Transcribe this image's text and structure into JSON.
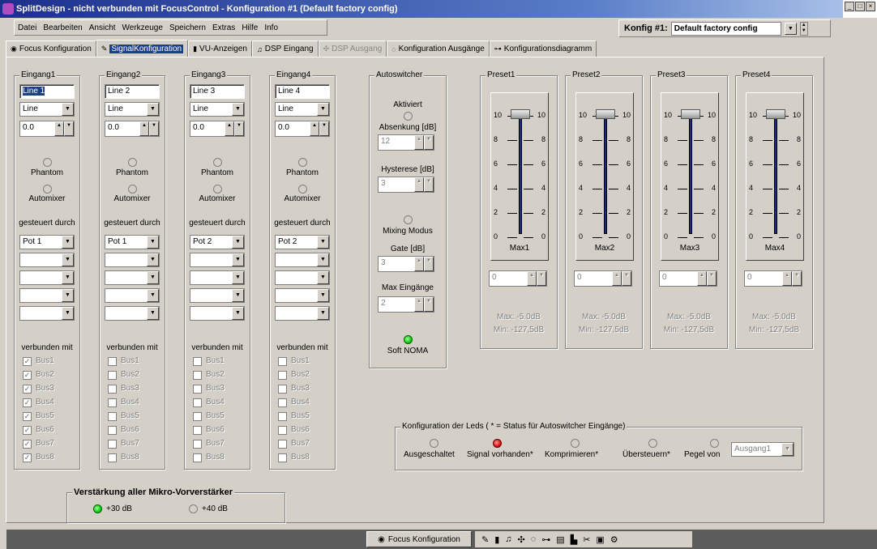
{
  "window": {
    "title": "SplitDesign - nicht verbunden mit FocusControl  -  Konfiguration #1 (Default factory config)",
    "controls": [
      "_",
      "□",
      "×"
    ]
  },
  "menu": [
    "Datei",
    "Bearbeiten",
    "Ansicht",
    "Werkzeuge",
    "Speichern",
    "Extras",
    "Hilfe",
    "Info"
  ],
  "konfig": {
    "label": "Konfig #1:",
    "value": "Default factory config"
  },
  "tabs": [
    {
      "label": "Focus Konfiguration",
      "icon": "focus-icon"
    },
    {
      "label": "SignalKonfiguration",
      "icon": "wrench-icon"
    },
    {
      "label": "VU-Anzeigen",
      "icon": "meter-icon"
    },
    {
      "label": "DSP Eingang",
      "icon": "dsp-in-icon"
    },
    {
      "label": "DSP Ausgang",
      "icon": "dsp-out-icon"
    },
    {
      "label": "Konfiguration Ausgänge",
      "icon": "outputs-icon"
    },
    {
      "label": "Konfigurationsdiagramm",
      "icon": "diagram-icon"
    }
  ],
  "inputs": [
    {
      "title": "Eingang1",
      "name": "Line 1",
      "type": "Line",
      "gain": "0.0",
      "phantom": "Phantom",
      "automixer": "Automixer",
      "controlled_label": "gesteuert durch",
      "controlled_by": "Pot 1",
      "connected_label": "verbunden mit",
      "buses": [
        "Bus1",
        "Bus2",
        "Bus3",
        "Bus4",
        "Bus5",
        "Bus6",
        "Bus7",
        "Bus8"
      ],
      "checked": [
        true,
        true,
        true,
        true,
        true,
        true,
        true,
        true
      ]
    },
    {
      "title": "Eingang2",
      "name": "Line 2",
      "type": "Line",
      "gain": "0.0",
      "phantom": "Phantom",
      "automixer": "Automixer",
      "controlled_label": "gesteuert durch",
      "controlled_by": "Pot 1",
      "connected_label": "verbunden mit",
      "buses": [
        "Bus1",
        "Bus2",
        "Bus3",
        "Bus4",
        "Bus5",
        "Bus6",
        "Bus7",
        "Bus8"
      ],
      "checked": [
        false,
        false,
        false,
        false,
        false,
        false,
        false,
        false
      ]
    },
    {
      "title": "Eingang3",
      "name": "Line 3",
      "type": "Line",
      "gain": "0.0",
      "phantom": "Phantom",
      "automixer": "Automixer",
      "controlled_label": "gesteuert durch",
      "controlled_by": "Pot 2",
      "connected_label": "verbunden mit",
      "buses": [
        "Bus1",
        "Bus2",
        "Bus3",
        "Bus4",
        "Bus5",
        "Bus6",
        "Bus7",
        "Bus8"
      ],
      "checked": [
        false,
        false,
        false,
        false,
        false,
        false,
        false,
        false
      ]
    },
    {
      "title": "Eingang4",
      "name": "Line 4",
      "type": "Line",
      "gain": "0.0",
      "phantom": "Phantom",
      "automixer": "Automixer",
      "controlled_label": "gesteuert durch",
      "controlled_by": "Pot 2",
      "connected_label": "verbunden mit",
      "buses": [
        "Bus1",
        "Bus2",
        "Bus3",
        "Bus4",
        "Bus5",
        "Bus6",
        "Bus7",
        "Bus8"
      ],
      "checked": [
        false,
        false,
        false,
        false,
        false,
        false,
        false,
        false
      ]
    }
  ],
  "autoswitcher": {
    "title": "Autoswitcher",
    "aktiviert": "Aktiviert",
    "absenkung_label": "Absenkung [dB]",
    "absenkung": "12",
    "hysterese_label": "Hysterese [dB]",
    "hysterese": "3",
    "mixing": "Mixing Modus",
    "gate_label": "Gate [dB]",
    "gate": "3",
    "max_label": "Max Eingänge",
    "max": "2",
    "soft": "Soft NOMA"
  },
  "presets": [
    {
      "title": "Preset1",
      "max": "Max1",
      "value": "0",
      "info1": "Max: -5.0dB",
      "info2": "Min: -127,5dB"
    },
    {
      "title": "Preset2",
      "max": "Max2",
      "value": "0",
      "info1": "Max: -5.0dB",
      "info2": "Min: -127,5dB"
    },
    {
      "title": "Preset3",
      "max": "Max3",
      "value": "0",
      "info1": "Max: -5.0dB",
      "info2": "Min: -127,5dB"
    },
    {
      "title": "Preset4",
      "max": "Max4",
      "value": "0",
      "info1": "Max: -5.0dB",
      "info2": "Min: -127,5dB"
    }
  ],
  "fader_scale": {
    "labels": [
      "10",
      "8",
      "6",
      "4",
      "2",
      "0"
    ],
    "level": 1.0
  },
  "leds": {
    "title": "Konfiguration der Leds ( * = Status für Autoswitcher Eingänge)",
    "options": [
      "Ausgeschaltet",
      "Signal vorhanden*",
      "Komprimieren*",
      "Übersteuern*",
      "Pegel von"
    ],
    "selected": 1,
    "pegel_select": "Ausgang1"
  },
  "mic": {
    "title": "Verstärkung aller Mikro-Vorverstärker",
    "options": [
      "+30 dB",
      "+40 dB"
    ],
    "selected": 0
  },
  "taskbar": {
    "item": "Focus Konfiguration",
    "icons": [
      "wrench-icon",
      "meter-icon",
      "dsp-in-icon",
      "dsp-out-icon",
      "outputs-icon",
      "diagram-icon",
      "vu-icon",
      "chart-icon",
      "tools-icon",
      "doc-icon",
      "settings-icon"
    ]
  },
  "colors": {
    "title_start": "#1c2f8c",
    "title_end": "#a8c0e8",
    "led_green": "#11cc11",
    "led_red": "#dd1111",
    "fader_track": "#1a2a8a"
  }
}
